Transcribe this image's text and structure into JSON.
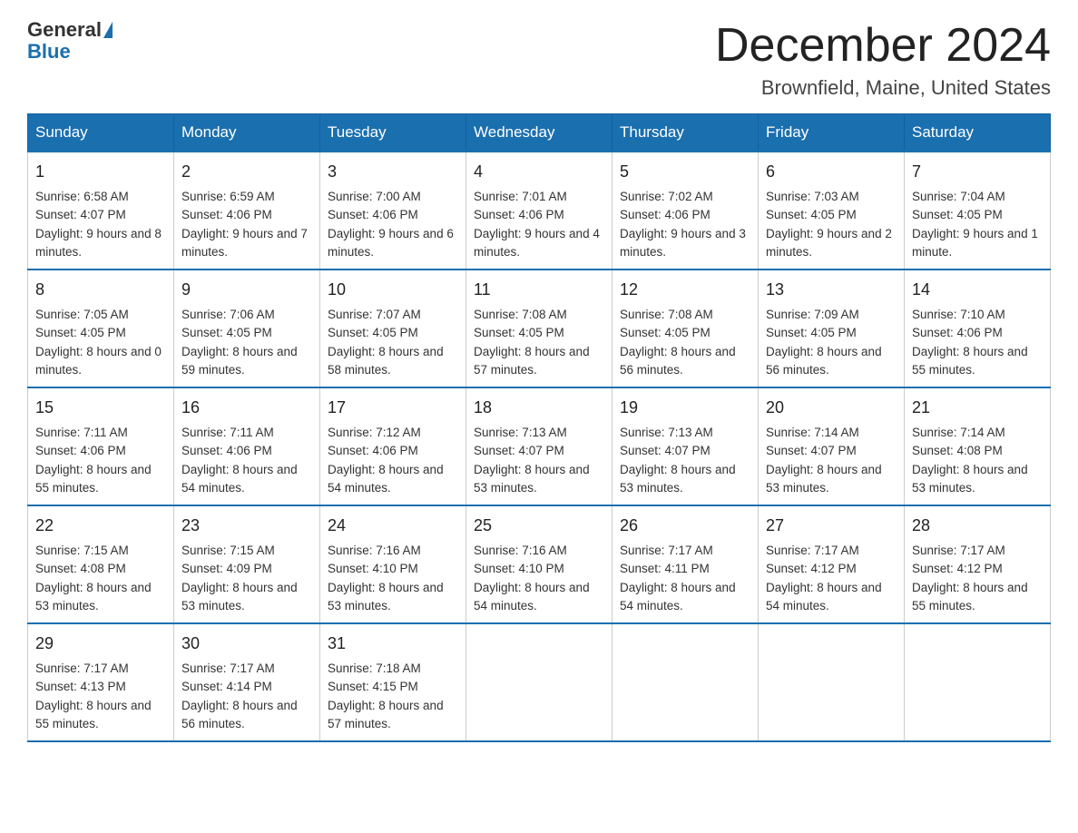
{
  "header": {
    "logo_general": "General",
    "logo_blue": "Blue",
    "month_title": "December 2024",
    "location": "Brownfield, Maine, United States"
  },
  "days_of_week": [
    "Sunday",
    "Monday",
    "Tuesday",
    "Wednesday",
    "Thursday",
    "Friday",
    "Saturday"
  ],
  "weeks": [
    [
      {
        "day": "1",
        "sunrise": "6:58 AM",
        "sunset": "4:07 PM",
        "daylight": "9 hours and 8 minutes."
      },
      {
        "day": "2",
        "sunrise": "6:59 AM",
        "sunset": "4:06 PM",
        "daylight": "9 hours and 7 minutes."
      },
      {
        "day": "3",
        "sunrise": "7:00 AM",
        "sunset": "4:06 PM",
        "daylight": "9 hours and 6 minutes."
      },
      {
        "day": "4",
        "sunrise": "7:01 AM",
        "sunset": "4:06 PM",
        "daylight": "9 hours and 4 minutes."
      },
      {
        "day": "5",
        "sunrise": "7:02 AM",
        "sunset": "4:06 PM",
        "daylight": "9 hours and 3 minutes."
      },
      {
        "day": "6",
        "sunrise": "7:03 AM",
        "sunset": "4:05 PM",
        "daylight": "9 hours and 2 minutes."
      },
      {
        "day": "7",
        "sunrise": "7:04 AM",
        "sunset": "4:05 PM",
        "daylight": "9 hours and 1 minute."
      }
    ],
    [
      {
        "day": "8",
        "sunrise": "7:05 AM",
        "sunset": "4:05 PM",
        "daylight": "8 hours and 0 minutes."
      },
      {
        "day": "9",
        "sunrise": "7:06 AM",
        "sunset": "4:05 PM",
        "daylight": "8 hours and 59 minutes."
      },
      {
        "day": "10",
        "sunrise": "7:07 AM",
        "sunset": "4:05 PM",
        "daylight": "8 hours and 58 minutes."
      },
      {
        "day": "11",
        "sunrise": "7:08 AM",
        "sunset": "4:05 PM",
        "daylight": "8 hours and 57 minutes."
      },
      {
        "day": "12",
        "sunrise": "7:08 AM",
        "sunset": "4:05 PM",
        "daylight": "8 hours and 56 minutes."
      },
      {
        "day": "13",
        "sunrise": "7:09 AM",
        "sunset": "4:05 PM",
        "daylight": "8 hours and 56 minutes."
      },
      {
        "day": "14",
        "sunrise": "7:10 AM",
        "sunset": "4:06 PM",
        "daylight": "8 hours and 55 minutes."
      }
    ],
    [
      {
        "day": "15",
        "sunrise": "7:11 AM",
        "sunset": "4:06 PM",
        "daylight": "8 hours and 55 minutes."
      },
      {
        "day": "16",
        "sunrise": "7:11 AM",
        "sunset": "4:06 PM",
        "daylight": "8 hours and 54 minutes."
      },
      {
        "day": "17",
        "sunrise": "7:12 AM",
        "sunset": "4:06 PM",
        "daylight": "8 hours and 54 minutes."
      },
      {
        "day": "18",
        "sunrise": "7:13 AM",
        "sunset": "4:07 PM",
        "daylight": "8 hours and 53 minutes."
      },
      {
        "day": "19",
        "sunrise": "7:13 AM",
        "sunset": "4:07 PM",
        "daylight": "8 hours and 53 minutes."
      },
      {
        "day": "20",
        "sunrise": "7:14 AM",
        "sunset": "4:07 PM",
        "daylight": "8 hours and 53 minutes."
      },
      {
        "day": "21",
        "sunrise": "7:14 AM",
        "sunset": "4:08 PM",
        "daylight": "8 hours and 53 minutes."
      }
    ],
    [
      {
        "day": "22",
        "sunrise": "7:15 AM",
        "sunset": "4:08 PM",
        "daylight": "8 hours and 53 minutes."
      },
      {
        "day": "23",
        "sunrise": "7:15 AM",
        "sunset": "4:09 PM",
        "daylight": "8 hours and 53 minutes."
      },
      {
        "day": "24",
        "sunrise": "7:16 AM",
        "sunset": "4:10 PM",
        "daylight": "8 hours and 53 minutes."
      },
      {
        "day": "25",
        "sunrise": "7:16 AM",
        "sunset": "4:10 PM",
        "daylight": "8 hours and 54 minutes."
      },
      {
        "day": "26",
        "sunrise": "7:17 AM",
        "sunset": "4:11 PM",
        "daylight": "8 hours and 54 minutes."
      },
      {
        "day": "27",
        "sunrise": "7:17 AM",
        "sunset": "4:12 PM",
        "daylight": "8 hours and 54 minutes."
      },
      {
        "day": "28",
        "sunrise": "7:17 AM",
        "sunset": "4:12 PM",
        "daylight": "8 hours and 55 minutes."
      }
    ],
    [
      {
        "day": "29",
        "sunrise": "7:17 AM",
        "sunset": "4:13 PM",
        "daylight": "8 hours and 55 minutes."
      },
      {
        "day": "30",
        "sunrise": "7:17 AM",
        "sunset": "4:14 PM",
        "daylight": "8 hours and 56 minutes."
      },
      {
        "day": "31",
        "sunrise": "7:18 AM",
        "sunset": "4:15 PM",
        "daylight": "8 hours and 57 minutes."
      },
      null,
      null,
      null,
      null
    ]
  ]
}
